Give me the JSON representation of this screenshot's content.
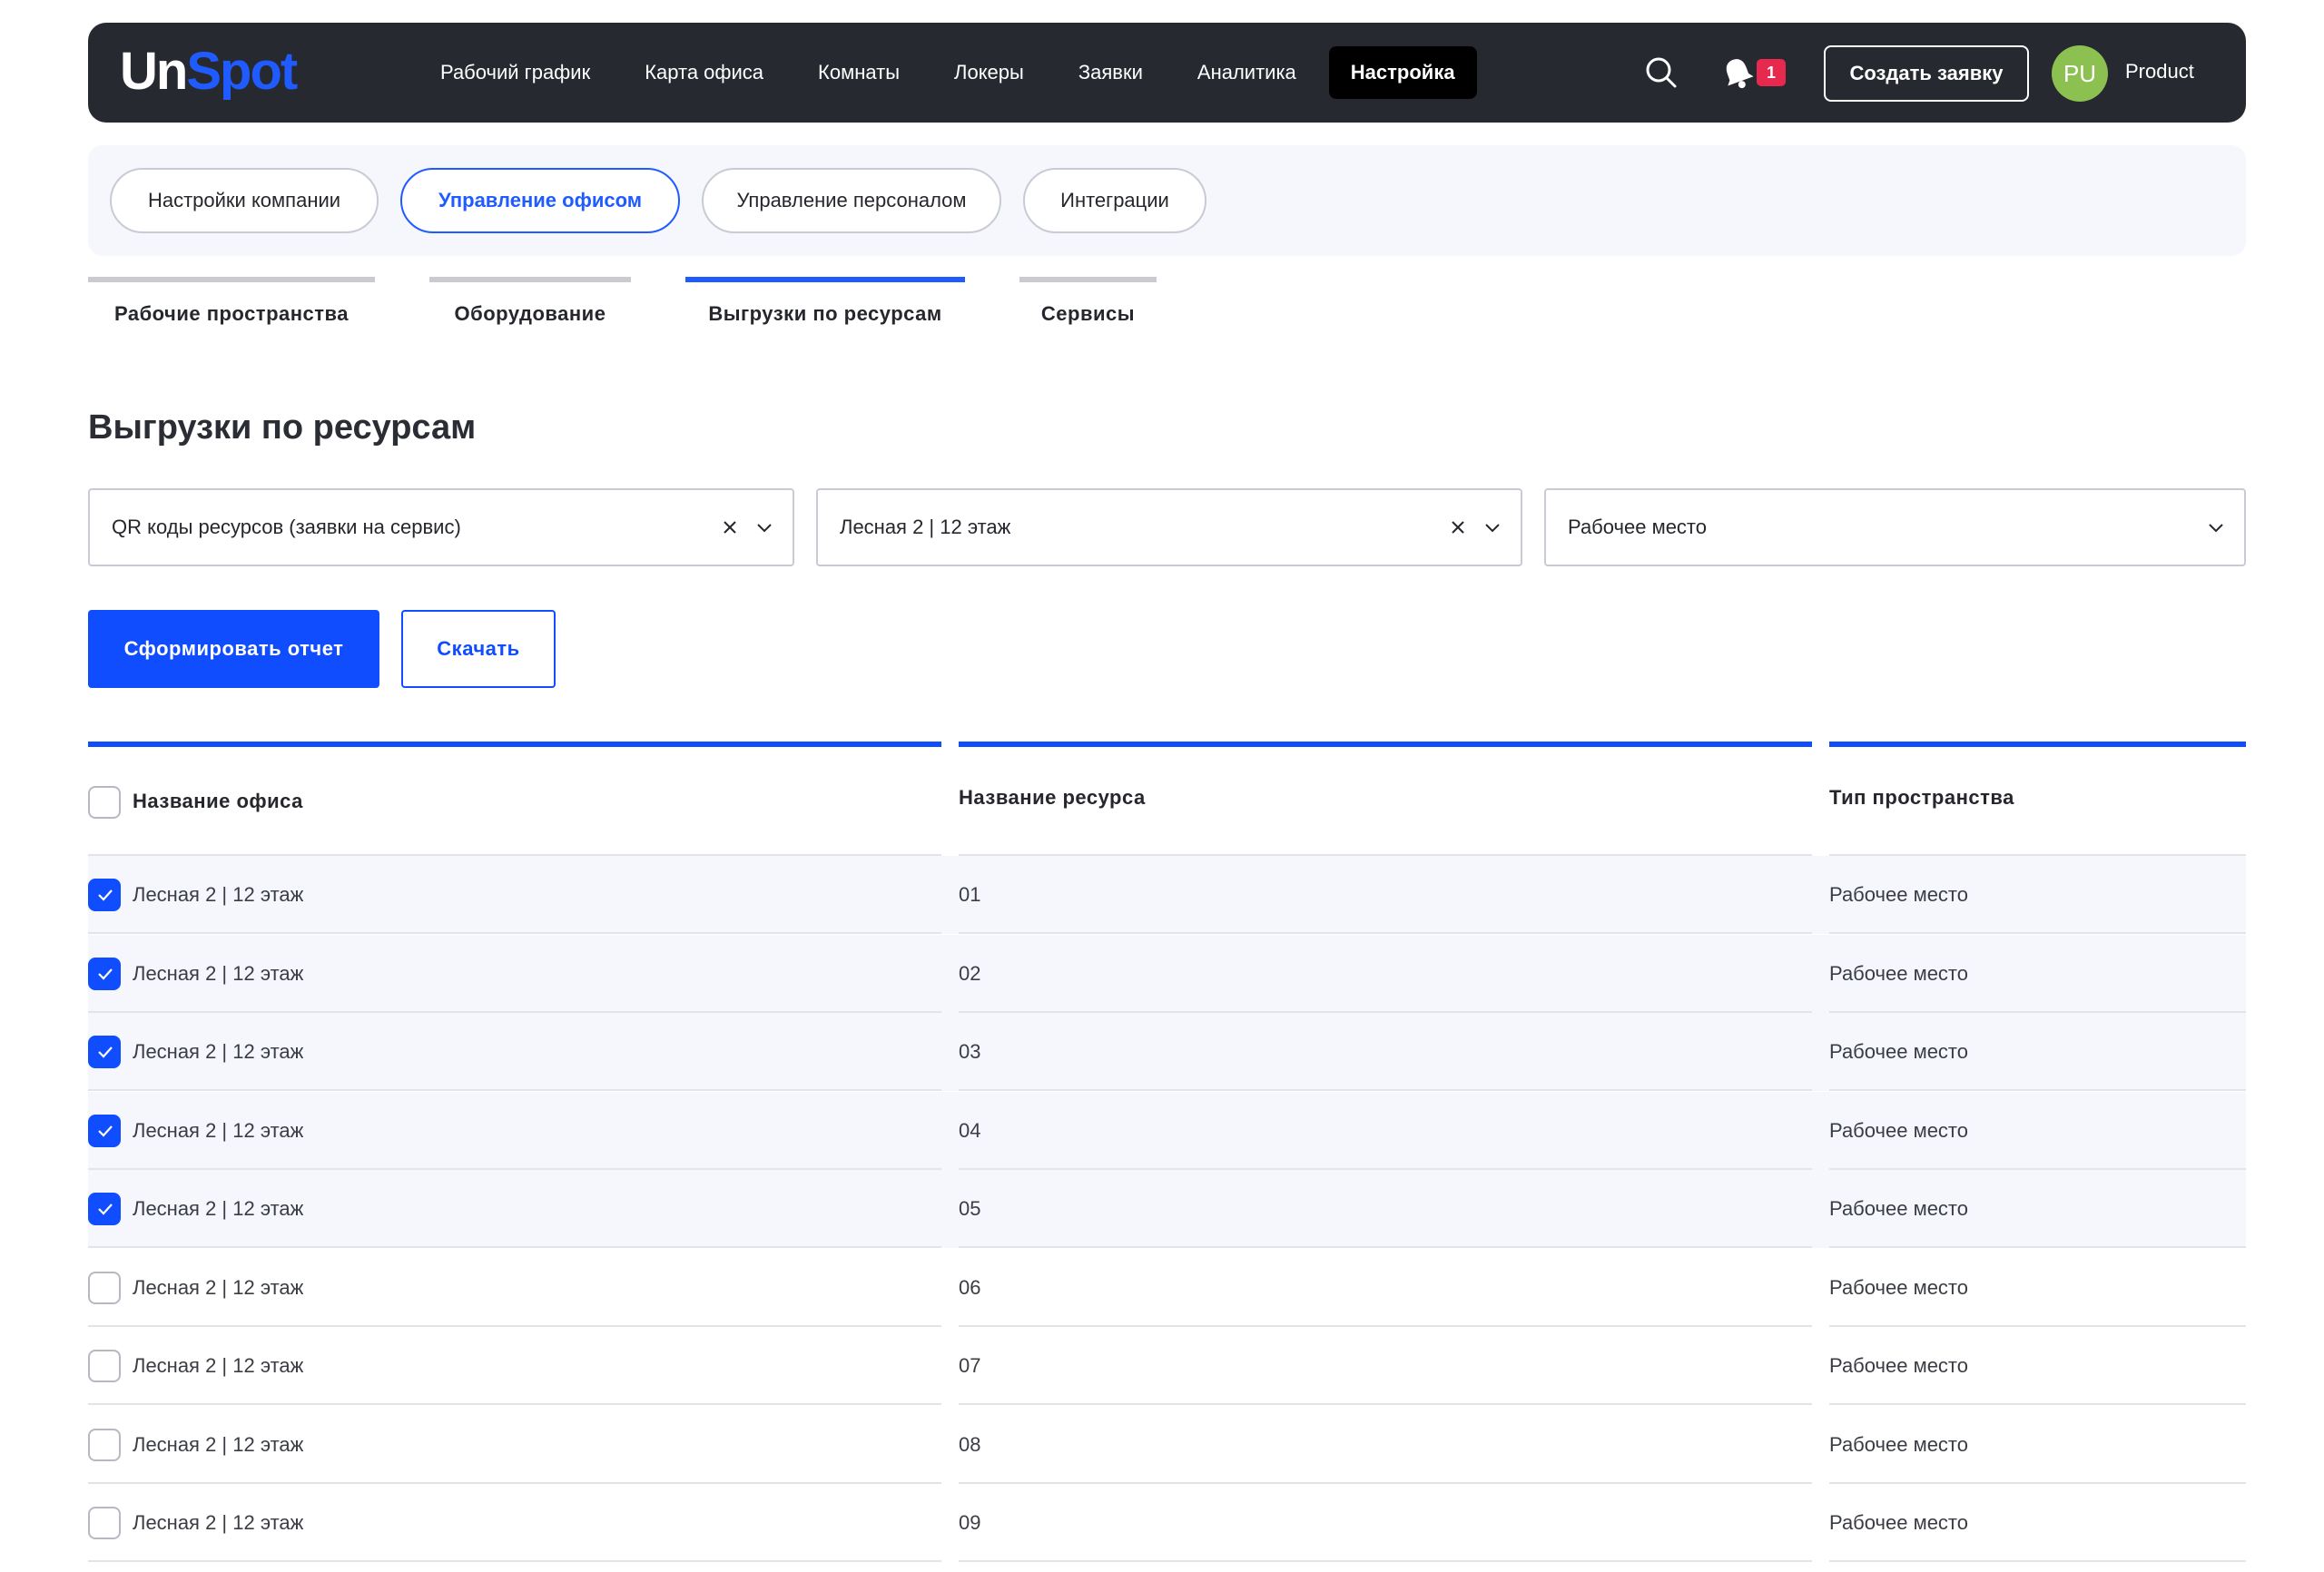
{
  "header": {
    "logo_un": "Un",
    "logo_spot": "Spot",
    "nav": [
      {
        "label": "Рабочий график",
        "active": false
      },
      {
        "label": "Карта офиса",
        "active": false
      },
      {
        "label": "Комнаты",
        "active": false
      },
      {
        "label": "Локеры",
        "active": false
      },
      {
        "label": "Заявки",
        "active": false
      },
      {
        "label": "Аналитика",
        "active": false
      },
      {
        "label": "Настройка",
        "active": true
      }
    ],
    "notification_count": "1",
    "create_label": "Создать заявку",
    "avatar_initials": "PU",
    "user_name": "Product"
  },
  "sections": [
    {
      "label": "Настройки компании",
      "active": false
    },
    {
      "label": "Управление офисом",
      "active": true
    },
    {
      "label": "Управление персоналом",
      "active": false
    },
    {
      "label": "Интеграции",
      "active": false
    }
  ],
  "subtabs": [
    {
      "label": "Рабочие пространства",
      "active": false
    },
    {
      "label": "Оборудование",
      "active": false
    },
    {
      "label": "Выгрузки по ресурсам",
      "active": true
    },
    {
      "label": "Сервисы",
      "active": false
    }
  ],
  "page_title": "Выгрузки по ресурсам",
  "filters": {
    "report_type": "QR коды ресурсов (заявки на сервис)",
    "office": "Лесная 2 | 12 этаж",
    "space_type": "Рабочее место"
  },
  "actions": {
    "generate_label": "Сформировать отчет",
    "download_label": "Скачать"
  },
  "table": {
    "headers": {
      "office": "Название офиса",
      "resource": "Название ресурса",
      "space_type": "Тип пространства"
    },
    "rows": [
      {
        "office": "Лесная 2 | 12 этаж",
        "resource": "01",
        "type": "Рабочее место",
        "checked": true
      },
      {
        "office": "Лесная 2 | 12 этаж",
        "resource": "02",
        "type": "Рабочее место",
        "checked": true
      },
      {
        "office": "Лесная 2 | 12 этаж",
        "resource": "03",
        "type": "Рабочее место",
        "checked": true
      },
      {
        "office": "Лесная 2 | 12 этаж",
        "resource": "04",
        "type": "Рабочее место",
        "checked": true
      },
      {
        "office": "Лесная 2 | 12 этаж",
        "resource": "05",
        "type": "Рабочее место",
        "checked": true
      },
      {
        "office": "Лесная 2 | 12 этаж",
        "resource": "06",
        "type": "Рабочее место",
        "checked": false
      },
      {
        "office": "Лесная 2 | 12 этаж",
        "resource": "07",
        "type": "Рабочее место",
        "checked": false
      },
      {
        "office": "Лесная 2 | 12 этаж",
        "resource": "08",
        "type": "Рабочее место",
        "checked": false
      },
      {
        "office": "Лесная 2 | 12 этаж",
        "resource": "09",
        "type": "Рабочее место",
        "checked": false
      }
    ]
  },
  "colors": {
    "accent": "#0f4dff",
    "topbar": "#262930",
    "badge": "#e6294d",
    "avatar": "#8cc152",
    "selected_row": "#f5f7fd"
  }
}
